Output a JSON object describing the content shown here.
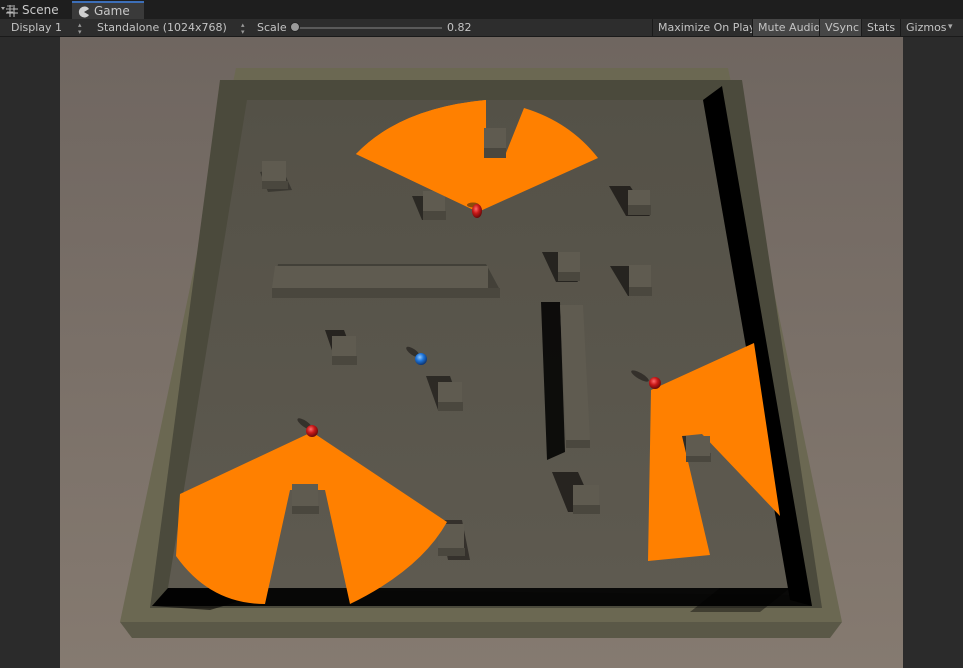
{
  "tabs": {
    "scene_label": "Scene",
    "game_label": "Game",
    "active": "Game"
  },
  "toolbar": {
    "display": "Display 1",
    "resolution": "Standalone (1024x768)",
    "scale_label": "Scale",
    "scale_value": "0.82",
    "maximize_on_play": "Maximize On Play",
    "mute_audio": "Mute Audio",
    "vsync": "VSync",
    "stats": "Stats",
    "gizmos": "Gizmos"
  },
  "game": {
    "colors": {
      "sky": "#7b7067",
      "wall": "#5c5a48",
      "floor": "#58554b",
      "vision_cone": "#ff8000",
      "enemy": "#cc1a1a",
      "player": "#1a6fd6"
    },
    "enemies": 3,
    "players": 1
  }
}
